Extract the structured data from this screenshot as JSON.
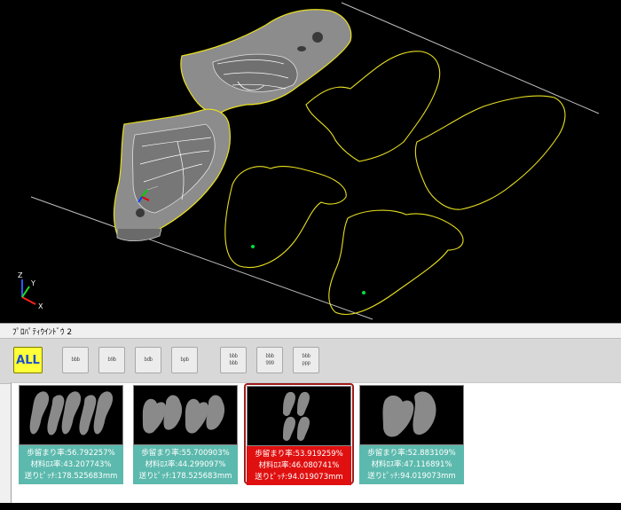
{
  "viewport": {
    "name": "3d-cad-viewport",
    "outline_color": "#e8e020",
    "axis_labels": {
      "x": "X",
      "y": "Y",
      "z": "Z"
    }
  },
  "property_window": {
    "title": "ﾌﾟﾛﾊﾟﾃｨｳｲﾝﾄﾞｳ 2",
    "toolbar": {
      "all_label": "ALL",
      "buttons": [
        {
          "name": "layout-pattern-1-button",
          "icon": "bbb"
        },
        {
          "name": "layout-pattern-2-button",
          "icon": "b9b"
        },
        {
          "name": "layout-pattern-3-button",
          "icon": "bdb"
        },
        {
          "name": "layout-pattern-4-button",
          "icon": "bpb"
        },
        {
          "name": "layout-grid-1-button",
          "icon": "bbb/bbb"
        },
        {
          "name": "layout-grid-2-button",
          "icon": "bbb/999"
        },
        {
          "name": "layout-grid-3-button",
          "icon": "bbb/ppp"
        }
      ]
    },
    "results": [
      {
        "yield": "歩留まり率:56.792257%",
        "loss": "材料ﾛｽ率:43.207743%",
        "pitch": "送りﾋﾟｯﾁ:178.525683mm",
        "selected": false
      },
      {
        "yield": "歩留まり率:55.700903%",
        "loss": "材料ﾛｽ率:44.299097%",
        "pitch": "送りﾋﾟｯﾁ:178.525683mm",
        "selected": false
      },
      {
        "yield": "歩留まり率:53.919259%",
        "loss": "材料ﾛｽ率:46.080741%",
        "pitch": "送りﾋﾟｯﾁ:94.019073mm",
        "selected": true
      },
      {
        "yield": "歩留まり率:52.883109%",
        "loss": "材料ﾛｽ率:47.116891%",
        "pitch": "送りﾋﾟｯﾁ:94.019073mm",
        "selected": false
      }
    ],
    "colors": {
      "info_bg": "#5cb9ad",
      "selected_bg": "#e01010",
      "all_button_bg": "#ffff3a"
    }
  }
}
